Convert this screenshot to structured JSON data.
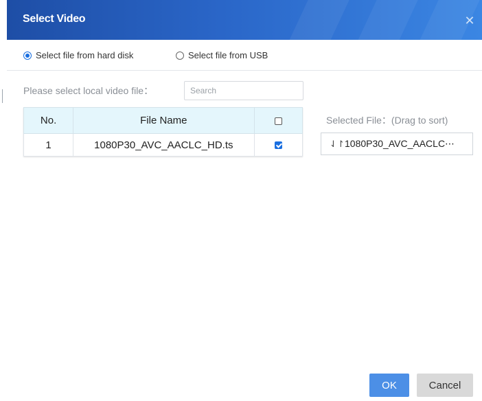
{
  "dialog": {
    "title": "Select Video",
    "close_icon": "close-icon"
  },
  "source": {
    "options": [
      {
        "label": "Select file from hard disk",
        "selected": true
      },
      {
        "label": "Select file from USB",
        "selected": false
      }
    ]
  },
  "local": {
    "label": "Please select local video file：",
    "search_placeholder": "Search"
  },
  "table": {
    "headers": {
      "no": "No.",
      "name": "File Name"
    },
    "select_all_checked": false,
    "rows": [
      {
        "no": "1",
        "name": "1080P30_AVC_AACLC_HD.ts",
        "checked": true
      }
    ]
  },
  "selected": {
    "label": "Selected File：(Drag to sort)",
    "items": [
      {
        "name": "1080P30_AVC_AACLC⋯",
        "icon": "sort-arrows-icon"
      }
    ]
  },
  "buttons": {
    "ok": "OK",
    "cancel": "Cancel"
  },
  "colors": {
    "title_bar": "#2a66c8",
    "accent": "#1a6fe0",
    "ok_button": "#4c8fe6",
    "table_header": "#e4f6fc"
  }
}
